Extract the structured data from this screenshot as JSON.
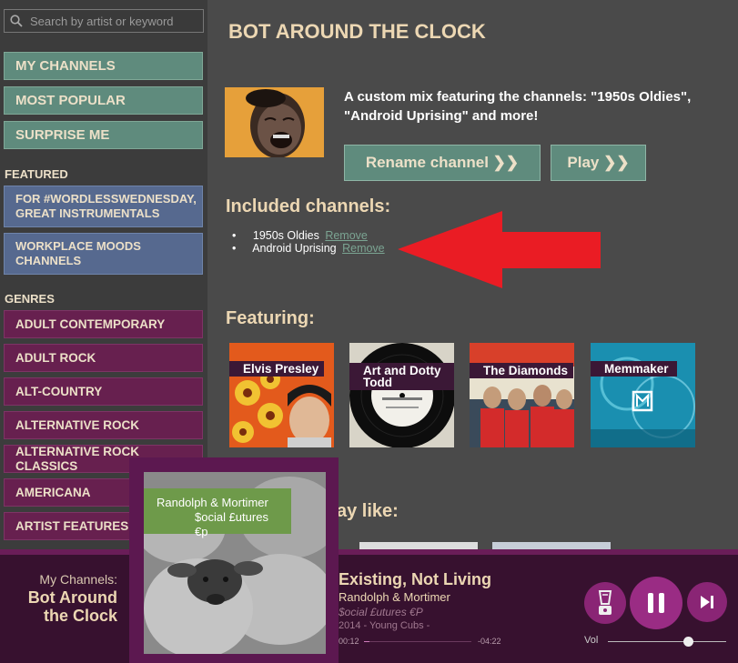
{
  "search": {
    "placeholder": "Search by artist or keyword"
  },
  "nav": {
    "my_channels": "MY CHANNELS",
    "most_popular": "MOST POPULAR",
    "surprise_me": "SURPRISE ME"
  },
  "featured": {
    "heading": "FEATURED",
    "items": [
      "FOR #WORDLESSWEDNESDAY, GREAT INSTRUMENTALS",
      "WORKPLACE MOODS CHANNELS"
    ]
  },
  "genres": {
    "heading": "GENRES",
    "items": [
      "ADULT CONTEMPORARY",
      "ADULT ROCK",
      "ALT-COUNTRY",
      "ALTERNATIVE ROCK",
      "ALTERNATIVE ROCK CLASSICS",
      "AMERICANA",
      "ARTIST FEATURES"
    ]
  },
  "main": {
    "title": "BOT AROUND THE CLOCK",
    "description": "A custom mix featuring the channels: \"1950s Oldies\", \"Android Uprising\" and more!",
    "rename_button": "Rename channel ❯❯",
    "play_button": "Play ❯❯",
    "included_heading": "Included channels:",
    "included": [
      {
        "name": "1950s Oldies",
        "action": "Remove"
      },
      {
        "name": "Android Uprising",
        "action": "Remove"
      }
    ],
    "featuring_heading": "Featuring:",
    "featuring": [
      "Elvis Presley",
      "Art and Dotty Todd",
      "The Diamonds",
      "Memmaker"
    ],
    "similar_heading": "ay like:"
  },
  "player": {
    "context_small": "My Channels:",
    "context_big": "Bot Around the Clock",
    "art_artist": "Randolph & Mortimer",
    "art_album": "$ocial £utures €p",
    "track_title": "Existing, Not Living",
    "track_artist": "Randolph & Mortimer",
    "track_album": "$ocial £utures €P",
    "track_year": "2014 - Young Cubs -",
    "elapsed": "00:12",
    "remaining": "-04:22",
    "progress": 0.05,
    "vol_label": "Vol",
    "volume": 0.68
  },
  "colors": {
    "accent_green": "#5f8b7d",
    "accent_purple": "#67204f",
    "arrow_red": "#ea1c24"
  },
  "icons": [
    "search-icon",
    "blender-icon",
    "pause-icon",
    "skip-next-icon",
    "red-arrow-annotation"
  ]
}
